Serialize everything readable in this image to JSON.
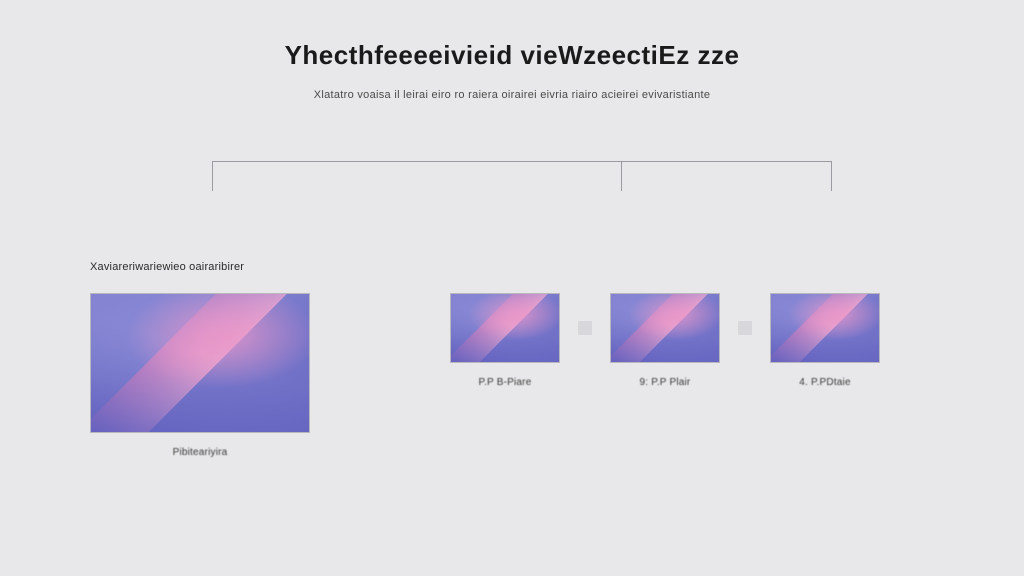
{
  "header": {
    "title": "Yhecthfeeeeivieid vieWzeectiEz zze",
    "subtitle": "Xlatatro voaisa il leirai eiro ro raiera oirairei eivria riairo acieirei evivaristiante"
  },
  "section": {
    "label": "Xaviareriwariewieo oairaribirer"
  },
  "cards": {
    "large": {
      "caption": "Pibiteariyira"
    },
    "small": [
      {
        "caption": "P.P B-Piare"
      },
      {
        "caption": "9: P.P Plair"
      },
      {
        "caption": "4. P.PDtaie"
      }
    ]
  }
}
